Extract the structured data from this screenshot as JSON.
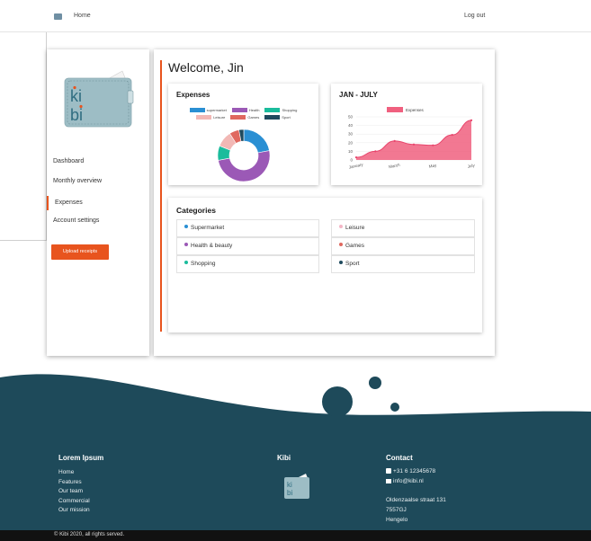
{
  "nav": {
    "home": "Home",
    "logout": "Log out"
  },
  "sidebar": {
    "logo_text_top": "ki",
    "logo_text_bottom": "bi",
    "items": [
      {
        "label": "Dashboard"
      },
      {
        "label": "Monthly overview"
      },
      {
        "label": "Expenses"
      },
      {
        "label": "Account settings"
      }
    ],
    "active_item": "Expenses",
    "upload_label": "Upload receipts"
  },
  "main": {
    "welcome": "Welcome, Jin"
  },
  "expenses_card": {
    "title": "Expenses",
    "chart_data": {
      "type": "pie",
      "labels": [
        "supermarket",
        "Health",
        "Shopping",
        "Leisure",
        "Games",
        "Sport"
      ],
      "values": [
        22,
        50,
        9,
        10,
        6,
        3
      ],
      "colors": [
        "#2a8fd3",
        "#9b59b6",
        "#1abc9c",
        "#f2b8b5",
        "#e0685f",
        "#1f4a5e"
      ]
    }
  },
  "trend_card": {
    "title": "JAN - JULY",
    "chart_data": {
      "type": "area",
      "x": [
        "January",
        "February",
        "March",
        "April",
        "May",
        "June",
        "July"
      ],
      "x_tick_labels": [
        "January",
        "March",
        "May",
        "July"
      ],
      "series": [
        {
          "name": "Expenses",
          "values": [
            3,
            10,
            22,
            18,
            17,
            29,
            46
          ]
        }
      ],
      "ylim": [
        0,
        50
      ],
      "y_ticks": [
        0,
        10,
        20,
        30,
        40,
        50
      ],
      "color": "#f0607f"
    }
  },
  "categories": {
    "title": "Categories",
    "left": [
      {
        "label": "Supermarket",
        "color": "#2a8fd3"
      },
      {
        "label": "Health & beauty",
        "color": "#9b59b6"
      },
      {
        "label": "Shopping",
        "color": "#1abc9c"
      }
    ],
    "right": [
      {
        "label": "Leisure",
        "color": "#f4b6c6"
      },
      {
        "label": "Games",
        "color": "#e0685f"
      },
      {
        "label": "Sport",
        "color": "#1f4a5e"
      }
    ]
  },
  "footer": {
    "col1_title": "Lorem Ipsum",
    "col1_links": [
      "Home",
      "Features",
      "Our team",
      "Commercial",
      "Our mission"
    ],
    "col2_title": "Kibi",
    "col3_title": "Contact",
    "phone": "+31 6 12345678",
    "email": "info@kibi.nl",
    "address": [
      "Oldenzaalse straat 131",
      "7557GJ",
      "Hengelo"
    ],
    "copyright": "© Kibi 2020, all rights served.",
    "bg_color": "#1e4a5a"
  },
  "colors": {
    "accent": "#e8541e",
    "footer": "#1e4a5a"
  }
}
